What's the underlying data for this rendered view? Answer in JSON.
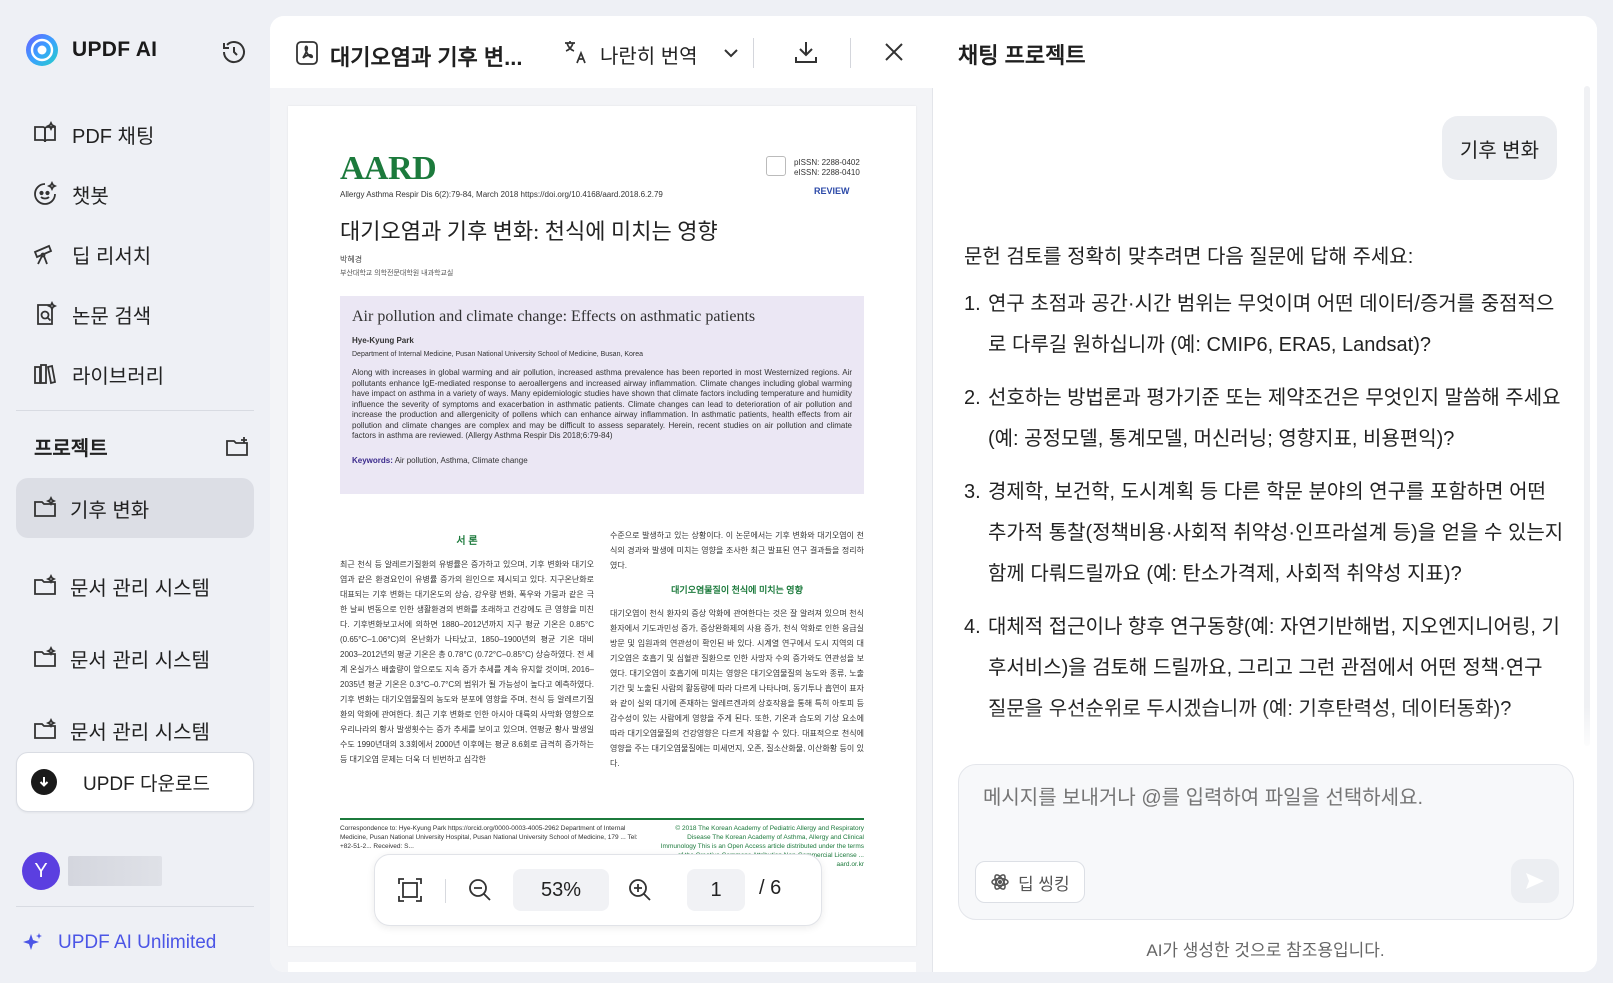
{
  "brand": {
    "name": "UPDF AI"
  },
  "sidebar": {
    "nav": [
      {
        "label": "PDF 채팅",
        "icon": "book-icon"
      },
      {
        "label": "챗봇",
        "icon": "bot-icon"
      },
      {
        "label": "딥 리서치",
        "icon": "telescope-icon"
      },
      {
        "label": "논문 검색",
        "icon": "search-doc-icon"
      },
      {
        "label": "라이브러리",
        "icon": "library-icon"
      }
    ],
    "projects_title": "프로젝트",
    "projects": [
      {
        "label": "기후 변화",
        "active": true
      },
      {
        "label": "문서 관리 시스템",
        "active": false
      },
      {
        "label": "문서 관리 시스템",
        "active": false
      },
      {
        "label": "문서 관리 시스템",
        "active": false
      }
    ],
    "download_label": "UPDF 다운로드",
    "user_initial": "Y",
    "unlimited_label": "UPDF AI Unlimited"
  },
  "viewer": {
    "file_title": "대기오염과 기후 변...",
    "translate_label": "나란히 번역",
    "zoom": "53%",
    "page_current": "1",
    "page_total": "/ 6"
  },
  "pdf": {
    "journal": "AARD",
    "citation": "Allergy Asthma Respir Dis 6(2):79-84, March 2018   https://doi.org/10.4168/aard.2018.6.2.79",
    "pissn": "pISSN: 2288-0402",
    "eissn": "eISSN: 2288-0410",
    "review": "REVIEW",
    "title_ko": "대기오염과 기후 변화: 천식에 미치는 영향",
    "author_ko": "박혜경",
    "affil_ko": "부산대학교 의학전문대학원 내과학교실",
    "title_en": "Air pollution and climate change: Effects on asthmatic patients",
    "author_en": "Hye-Kyung Park",
    "affil_en": "Department of Internal Medicine, Pusan National University School of Medicine, Busan, Korea",
    "abstract": "Along with increases in global warming and air pollution, increased asthma prevalence has been reported in most Westernized regions. Air pollutants enhance IgE-mediated response to aeroallergens and increased airway inflammation. Climate changes including global warming have impact on asthma in a variety of ways. Many epidemiologic studies have shown that climate factors including temperature and humidity influence the severity of symptoms and exacerbation in asthmatic patients. Climate changes can lead to deterioration of air pollution and increase the production and allergenicity of pollens which can enhance airway inflammation. In asthmatic patients, health effects from air pollution and climate changes are complex and may be difficult to assess separately. Herein, recent studies on air pollution and climate factors in asthma are reviewed. (Allergy Asthma Respir Dis 2018;6:79-84)",
    "keywords_label": "Keywords:",
    "keywords": "Air pollution, Asthma, Climate change",
    "sec1": "서 론",
    "body_left": "최근 천식 등 알레르기질환의 유병률은 증가하고 있으며, 기후 변화와 대기오염과 같은 환경요인이 유병률 증가의 원인으로 제시되고 있다. 지구온난화로 대표되는 기후 변화는 대기온도의 상승, 강우량 변화, 폭우와 가뭄과 같은 극한 날씨 변동으로 인한 생활환경의 변화를 초래하고 건강에도 큰 영향을 미친다. 기후변화보고서에 의하면 1880–2012년까지 지구 평균 기온은 0.85°C (0.65°C–1.06°C)의 온난화가 나타났고, 1850–1900년의 평균 기온 대비 2003–2012년의 평균 기온은 총 0.78°C (0.72°C–0.85°C) 상승하였다. 전 세계 온실가스 배출량이 앞으로도 지속 증가 추세를 계속 유지할 것이며, 2016–2035년 평균 기온은 0.3°C–0.7°C의 범위가 될 가능성이 높다고 예측하였다. 기후 변화는 대기오염물질의 농도와 분포에 영향을 주며, 천식 등 알레르기질환의 악화에 관여한다. 최근 기후 변화로 인한 아시아 대륙의 사막화 영향으로 우리나라의 황사 발생횟수는 증가 추세를 보이고 있으며, 연평균 황사 발생일수도 1990년대의 3.3회에서 2000년 이후에는 평균 8.6회로 급격히 증가하는 등 대기오염 문제는 더욱 더 빈번하고 심각한",
    "body_right_top": "수준으로 발생하고 있는 상황이다. 이 논문에서는 기후 변화와 대기오염이 천식의 경과와 발생에 미치는 영향을 조사한 최근 발표된 연구 결과들을 정리하였다.",
    "sec2": "대기오염물질이 천식에 미치는 영향",
    "body_right": "대기오염이 천식 환자의 증상 악화에 관여한다는 것은 잘 알려져 있으며 천식 환자에서 기도과민성 증가, 증상완화제의 사용 증가, 천식 악화로 인한 응급실 방문 및 입원과의 연관성이 확인된 바 있다. 시계열 연구에서 도시 지역의 대기오염은 호흡기 및 심혈관 질환으로 인한 사망자 수의 증가와도 연관성을 보였다. 대기오염이 호흡기에 미치는 영향은 대기오염물질의 농도와 종류, 노출 기간 및 노출된 사람의 활동량에 따라 다르게 나타나며, 동기투나 흡연이 표자와 같이 실외 대기에 존재하는 알레르겐과의 상호작용을 통해 특히 아토피 등 감수성이 있는 사람에게 영향을 주게 된다. 또한, 기온과 습도의 기상 요소에 따라 대기오염물질의 건강영향은 다르게 작용할 수 있다. 대표적으로 천식에 영향을 주는 대기오염물질에는 미세먼지, 오존, 질소산화물, 이산화황 등이 있다.",
    "footer": "Correspondence to: Hye-Kyung Park   https://orcid.org/0000-0003-4005-2962  Department of Internal Medicine, Pusan National University Hospital, Pusan National University School of Medicine, 179 ... Tel: +82-51-2... Received: S...",
    "footer_right": "© 2018 The Korean Academy of Pediatric Allergy and Respiratory Disease  The Korean Academy of Asthma, Allergy and Clinical Immunology  This is an Open Access article distributed under the terms of the Creative Commons Attribution Non-Commercial License ... aard.or.kr"
  },
  "chat": {
    "title": "채팅 프로젝트",
    "user_message": "기후 변화",
    "ai_intro": "문헌 검토를 정확히 맞추려면 다음 질문에 답해 주세요:",
    "ai_items": [
      {
        "num": "1.",
        "text": "연구 초점과 공간·시간 범위는 무엇이며 어떤 데이터/증거를 중점적으로 다루길 원하십니까 (예: CMIP6, ERA5, Landsat)?"
      },
      {
        "num": "2.",
        "text": "선호하는 방법론과 평가기준 또는 제약조건은 무엇인지 말씀해 주세요 (예: 공정모델, 통계모델, 머신러닝; 영향지표, 비용편익)?"
      },
      {
        "num": "3.",
        "text": "경제학, 보건학, 도시계획 등 다른 학문 분야의 연구를 포함하면 어떤 추가적 통찰(정책비용·사회적 취약성·인프라설계 등)을 얻을 수 있는지 함께 다뤄드릴까요 (예: 탄소가격제, 사회적 취약성 지표)?"
      },
      {
        "num": "4.",
        "text": "대체적 접근이나 향후 연구동향(예: 자연기반해법, 지오엔지니어링, 기후서비스)을 검토해 드릴까요, 그리고 그런 관점에서 어떤 정책·연구 질문을 우선순위로 두시겠습니까 (예: 기후탄력성, 데이터동화)?"
      }
    ],
    "input_placeholder": "메시지를 보내거나 @를 입력하여 파일을 선택하세요.",
    "deep_think_label": "딥 씽킹",
    "disclaimer": "AI가 생성한 것으로 참조용입니다."
  },
  "colors": {
    "accent": "#4b55e6",
    "journal_green": "#1c7a3c",
    "avatar": "#5b3fe0"
  }
}
